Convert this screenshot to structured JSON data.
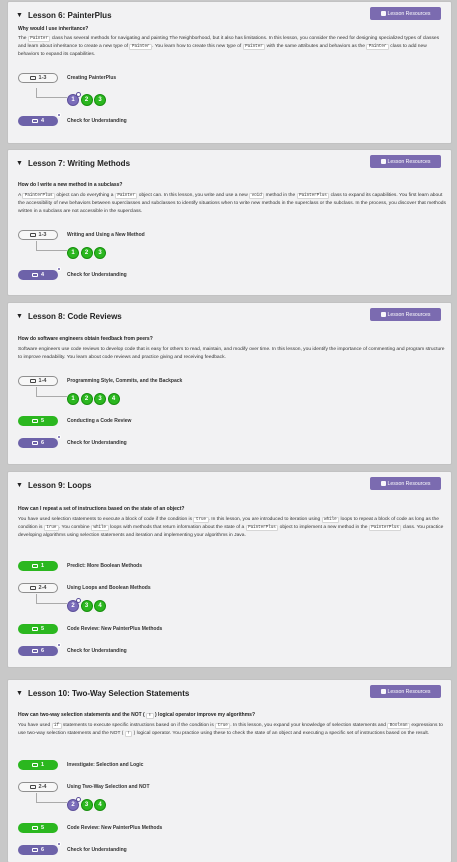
{
  "resources_label": "Lesson Resources",
  "lessons": [
    {
      "title": "Lesson 6: PainterPlus",
      "question": "Why would I use inheritance?",
      "desc": [
        {
          "t": "The "
        },
        {
          "c": "Painter"
        },
        {
          "t": " class has several methods for navigating and painting The Neighborhood, but it also has limitations. In this lesson, you consider the need for designing specialized types of classes and learn about inheritance to create a new type of "
        },
        {
          "c": "Painter"
        },
        {
          "t": ". You learn how to create this new type of "
        },
        {
          "c": "Painter"
        },
        {
          "t": " with the same attributes and behaviors as the "
        },
        {
          "c": "Painter"
        },
        {
          "t": " class to add new behaviors to expand its capabilities."
        }
      ],
      "items": [
        {
          "type": "pill",
          "style": "gray",
          "icon": "list-icon",
          "label": "1-3",
          "text": "Creating PainterPlus"
        },
        {
          "type": "levels",
          "levels": [
            {
              "n": "1",
              "state": "p"
            },
            {
              "n": "2",
              "state": "g"
            },
            {
              "n": "3",
              "state": "g"
            }
          ]
        },
        {
          "type": "pill",
          "style": "purple",
          "icon": "list-icon",
          "label": "4",
          "text": "Check for Understanding"
        }
      ]
    },
    {
      "title": "Lesson 7: Writing Methods",
      "question": "How do I write a new method in a subclass?",
      "desc": [
        {
          "t": "A "
        },
        {
          "c": "PainterPlus"
        },
        {
          "t": " object can do everything a "
        },
        {
          "c": "Painter"
        },
        {
          "t": " object can. In this lesson, you write and use a new "
        },
        {
          "c": "void"
        },
        {
          "t": " method in the "
        },
        {
          "c": "PainterPlus"
        },
        {
          "t": " class to expand its capabilities. You first learn about the accessibility of new behaviors between superclasses and subclasses to identify situations when to write new methods in the superclass or the subclass. In the process, you discover that methods written in a subclass are not accessible in the superclass."
        }
      ],
      "items": [
        {
          "type": "pill",
          "style": "gray",
          "icon": "monitor-icon",
          "label": "1-3",
          "text": "Writing and Using a New Method"
        },
        {
          "type": "levels",
          "levels": [
            {
              "n": "1",
              "state": "g"
            },
            {
              "n": "2",
              "state": "g"
            },
            {
              "n": "3",
              "state": "g"
            }
          ]
        },
        {
          "type": "pill",
          "style": "purple",
          "icon": "list-icon",
          "label": "4",
          "text": "Check for Understanding"
        }
      ]
    },
    {
      "title": "Lesson 8: Code Reviews",
      "question": "How do software engineers obtain feedback from peers?",
      "desc": [
        {
          "t": "Software engineers use code reviews to develop code that is easy for others to read, maintain, and modify over time. In this lesson, you identify the importance of commenting and program structure to improve readability. You learn about code reviews and practice giving and receiving feedback."
        }
      ],
      "items": [
        {
          "type": "pill",
          "style": "gray",
          "icon": "monitor-icon",
          "label": "1-4",
          "text": "Programming Style, Commits, and the Backpack"
        },
        {
          "type": "levels",
          "levels": [
            {
              "n": "1",
              "state": "g"
            },
            {
              "n": "2",
              "state": "g"
            },
            {
              "n": "3",
              "state": "g"
            },
            {
              "n": "4",
              "state": "g"
            }
          ]
        },
        {
          "type": "pill",
          "style": "green",
          "icon": "monitor-icon",
          "label": "5",
          "text": "Conducting a Code Review"
        },
        {
          "type": "pill",
          "style": "purple",
          "icon": "list-icon",
          "label": "6",
          "text": "Check for Understanding"
        }
      ]
    },
    {
      "title": "Lesson 9: Loops",
      "question": "How can I repeat a set of instructions based on the state of an object?",
      "desc": [
        {
          "t": "You have used selection statements to execute a block of code if the condition is "
        },
        {
          "c": "true"
        },
        {
          "t": ". In this lesson, you are introduced to iteration using "
        },
        {
          "c": "while"
        },
        {
          "t": " loops to repeat a block of code as long as the condition is "
        },
        {
          "c": "true"
        },
        {
          "t": ". You combine "
        },
        {
          "c": "while"
        },
        {
          "t": " loops with methods that return information about the state of a "
        },
        {
          "c": "PainterPlus"
        },
        {
          "t": " object to implement a new method in the "
        },
        {
          "c": "PainterPlus"
        },
        {
          "t": " class. You practice developing algorithms using selection statements and iteration and implementing your algorithms in Java."
        }
      ],
      "items": [
        {
          "type": "pill",
          "style": "green",
          "icon": "monitor-icon",
          "label": "1",
          "text": "Predict: More Boolean Methods"
        },
        {
          "type": "pill",
          "style": "gray",
          "icon": "monitor-icon",
          "label": "2-4",
          "text": "Using Loops and Boolean Methods"
        },
        {
          "type": "levels",
          "levels": [
            {
              "n": "2",
              "state": "p"
            },
            {
              "n": "3",
              "state": "g"
            },
            {
              "n": "4",
              "state": "g"
            }
          ]
        },
        {
          "type": "pill",
          "style": "green",
          "icon": "monitor-icon",
          "label": "5",
          "text": "Code Review: New PainterPlus Methods"
        },
        {
          "type": "pill",
          "style": "purple",
          "icon": "list-icon",
          "label": "6",
          "text": "Check for Understanding"
        }
      ]
    },
    {
      "title": "Lesson 10: Two-Way Selection Statements",
      "question_parts": [
        {
          "t": "How can two-way selection statements and the NOT ( "
        },
        {
          "c": "!"
        },
        {
          "t": " ) logical operator improve my algorithms?"
        }
      ],
      "desc": [
        {
          "t": "You have used "
        },
        {
          "c": "if"
        },
        {
          "t": " statements to execute specific instructions based on if the condition is "
        },
        {
          "c": "true"
        },
        {
          "t": ". In this lesson, you expand your knowledge of selection statements and "
        },
        {
          "c": "Boolean"
        },
        {
          "t": " expressions to use two-way selection statements and the NOT ( "
        },
        {
          "c": "!"
        },
        {
          "t": " ) logical operator. You practice using these to check the state of an object and executing a specific set of instructions based on the result."
        }
      ],
      "items": [
        {
          "type": "pill",
          "style": "green",
          "icon": "monitor-icon",
          "label": "1",
          "text": "Investigate: Selection and Logic"
        },
        {
          "type": "pill",
          "style": "gray",
          "icon": "list-icon",
          "label": "2-4",
          "text": "Using Two-Way Selection and NOT"
        },
        {
          "type": "levels",
          "levels": [
            {
              "n": "2",
              "state": "p"
            },
            {
              "n": "3",
              "state": "g"
            },
            {
              "n": "4",
              "state": "g"
            }
          ]
        },
        {
          "type": "pill",
          "style": "green",
          "icon": "monitor-icon",
          "label": "5",
          "text": "Code Review: New PainterPlus Methods"
        },
        {
          "type": "pill",
          "style": "purple",
          "icon": "list-icon",
          "label": "6",
          "text": "Check for Understanding"
        }
      ]
    }
  ]
}
